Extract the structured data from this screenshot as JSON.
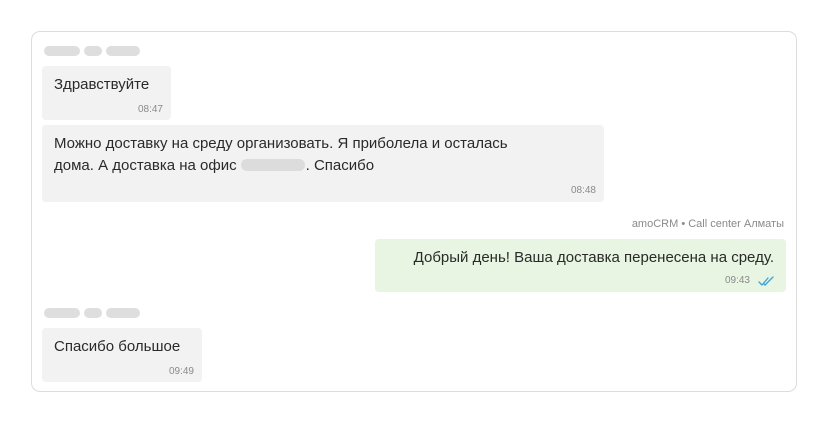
{
  "messages": [
    {
      "text": "Здравствуйте",
      "time": "08:47"
    },
    {
      "line1": "Можно доставку на среду организовать. Я приболела и осталась",
      "line2_before": "дома. А доставка на офис",
      "line2_after": ". Спасибо",
      "time": "08:48"
    },
    {
      "sender": "amoCRM • Call center Алматы",
      "text": "Добрый день! Ваша доставка перенесена на среду.",
      "time": "09:43"
    },
    {
      "text": "Спасибо большое",
      "time": "09:49"
    }
  ],
  "colors": {
    "incoming": "#f2f2f2",
    "outgoing": "#e7f5e2",
    "read_ticks": "#3aa3d8"
  },
  "icons": {
    "read_status": "double-check-icon"
  }
}
